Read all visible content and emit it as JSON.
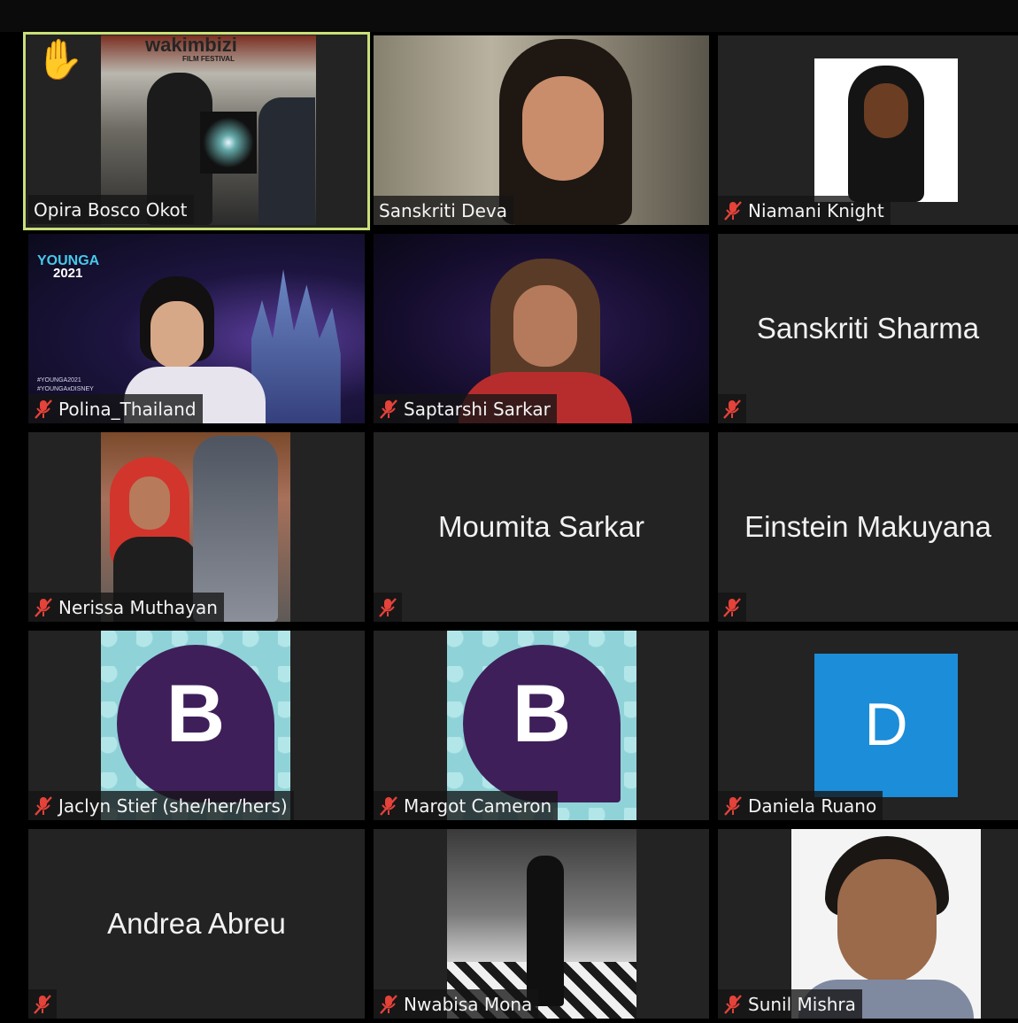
{
  "participants": [
    {
      "name": "Opira Bosco Okot",
      "muted": false,
      "raised_hand": true,
      "active": true
    },
    {
      "name": "Sanskriti Deva",
      "muted": false
    },
    {
      "name": "Niamani Knight",
      "muted": true
    },
    {
      "name": "Polina_Thailand",
      "muted": true
    },
    {
      "name": "Saptarshi Sarkar",
      "muted": true
    },
    {
      "name": "Sanskriti Sharma",
      "muted": true
    },
    {
      "name": "Nerissa Muthayan",
      "muted": true
    },
    {
      "name": "Moumita Sarkar",
      "muted": true
    },
    {
      "name": "Einstein Makuyana",
      "muted": true
    },
    {
      "name": "Jaclyn Stief (she/her/hers)",
      "muted": true
    },
    {
      "name": "Margot Cameron",
      "muted": true
    },
    {
      "name": "Daniela Ruano",
      "muted": true
    },
    {
      "name": "Andrea Abreu",
      "muted": true
    },
    {
      "name": "Nwabisa Mona",
      "muted": true
    },
    {
      "name": "Sunil Mishra",
      "muted": true
    }
  ],
  "video_text": {
    "banner_title": "wakimbizi",
    "banner_sub": "FILM FESTIVAL",
    "younga_logo": "YOUNGA",
    "younga_year": "2021",
    "hashtag1": "#YOUNGA2021",
    "hashtag2": "#YOUNGAxDISNEY",
    "avatar_b": "B",
    "avatar_d": "D"
  },
  "colors": {
    "active_border": "#c9e078",
    "tile_bg": "#232323",
    "mute_red": "#e5423a",
    "avatar_purple": "#3f1f5a",
    "avatar_teal_bg": "#8fd3d8",
    "avatar_blue": "#1c8dd8"
  },
  "icons": [
    "raised-hand-icon",
    "muted-microphone-icon"
  ]
}
